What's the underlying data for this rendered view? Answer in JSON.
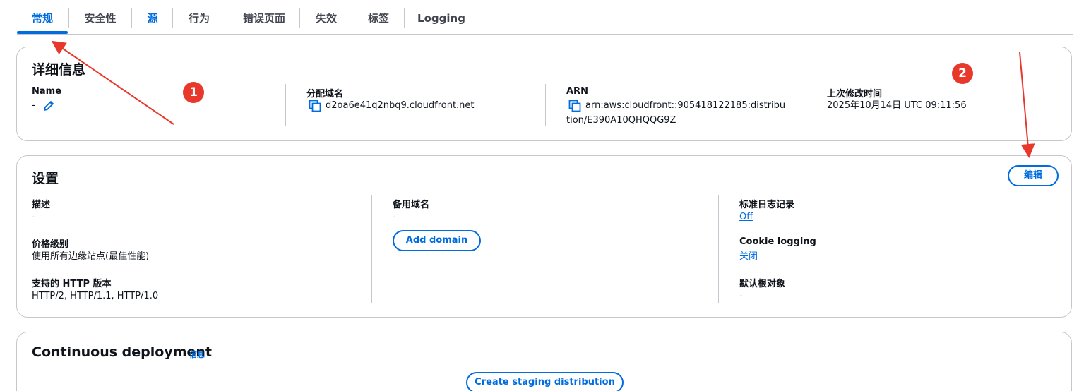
{
  "tabs": [
    {
      "label": "常规",
      "active": true
    },
    {
      "label": "安全性"
    },
    {
      "label": "源"
    },
    {
      "label": "行为"
    },
    {
      "label": "错误页面"
    },
    {
      "label": "失效"
    },
    {
      "label": "标签"
    },
    {
      "label": "Logging"
    }
  ],
  "details": {
    "title": "详细信息",
    "name_label": "Name",
    "name_value": "-",
    "domain_label": "分配域名",
    "domain_value": "d2oa6e41q2nbq9.cloudfront.net",
    "arn_label": "ARN",
    "arn_value_line1": "arn:aws:cloudfront::905418122185:distribu",
    "arn_value_line2": "tion/E390A10QHQQG9Z",
    "modified_label": "上次修改时间",
    "modified_value": "2025年10月14日 UTC 09:11:56"
  },
  "settings": {
    "title": "设置",
    "edit_button": "编辑",
    "description_label": "描述",
    "description_value": "-",
    "price_label": "价格级别",
    "price_value": "使用所有边缘站点(最佳性能)",
    "http_label": "支持的 HTTP 版本",
    "http_value": "HTTP/2, HTTP/1.1, HTTP/1.0",
    "alt_domain_label": "备用域名",
    "alt_domain_value": "-",
    "add_domain_button": "Add domain",
    "std_log_label": "标准日志记录",
    "std_log_value": "Off",
    "cookie_label": "Cookie logging",
    "cookie_value": "关闭",
    "root_object_label": "默认根对象",
    "root_object_value": "-"
  },
  "continuous": {
    "title": "Continuous deployment",
    "info_link": "信息",
    "staging_button": "Create staging distribution"
  },
  "annotations": {
    "badge1": "1",
    "badge2": "2",
    "color": "#e8382c"
  },
  "colors": {
    "accent": "#006ce0",
    "border": "#c6c6cd",
    "text": "#0f141a"
  }
}
